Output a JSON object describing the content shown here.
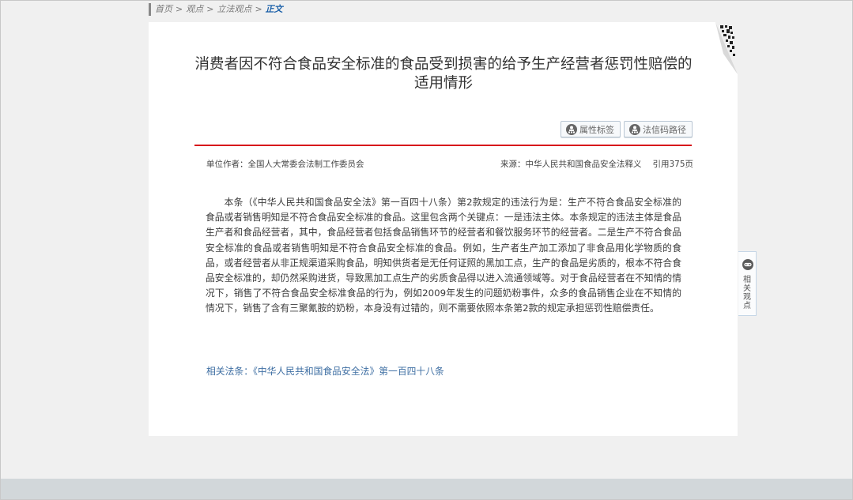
{
  "breadcrumb": {
    "items": [
      "首页",
      "观点",
      "立法观点"
    ],
    "current": "正文",
    "separator": ">"
  },
  "article": {
    "title": "消费者因不符合食品安全标准的食品受到损害的给予生产经营者惩罚性赔偿的适用情形",
    "buttons": {
      "attribute_tag": "属性标签",
      "law_code_path": "法信码路径"
    },
    "author": "单位作者：全国人大常委会法制工作委员会",
    "source": "来源：中华人民共和国食品安全法释义",
    "citation": "引用375页",
    "body": "本条（《中华人民共和国食品安全法》第一百四十八条）第2款规定的违法行为是：生产不符合食品安全标准的食品或者销售明知是不符合食品安全标准的食品。这里包含两个关键点：一是违法主体。本条规定的违法主体是食品生产者和食品经营者，其中，食品经营者包括食品销售环节的经营者和餐饮服务环节的经营者。二是生产不符合食品安全标准的食品或者销售明知是不符合食品安全标准的食品。例如，生产者生产加工添加了非食品用化学物质的食品，或者经营者从非正规渠道采购食品，明知供货者是无任何证照的黑加工点，生产的食品是劣质的，根本不符合食品安全标准的，却仍然采购进货，导致黑加工点生产的劣质食品得以进入流通领域等。对于食品经营者在不知情的情况下，销售了不符合食品安全标准食品的行为，例如2009年发生的问题奶粉事件，众多的食品销售企业在不知情的情况下，销售了含有三聚氰胺的奶粉，本身没有过错的，则不需要依照本条第2款的规定承担惩罚性赔偿责任。",
    "related_law": "相关法条：《中华人民共和国食品安全法》第一百四十八条"
  },
  "side_tab": {
    "label": "相关观点",
    "icon": "link-icon"
  },
  "icons": {
    "attribute_tag": "user-tree-icon",
    "law_code_path": "user-tree-icon",
    "qr": "qr-code-icon"
  },
  "colors": {
    "accent_red": "#d7111b",
    "link_blue": "#3f6fa3",
    "breadcrumb_current": "#1a5fa8"
  }
}
